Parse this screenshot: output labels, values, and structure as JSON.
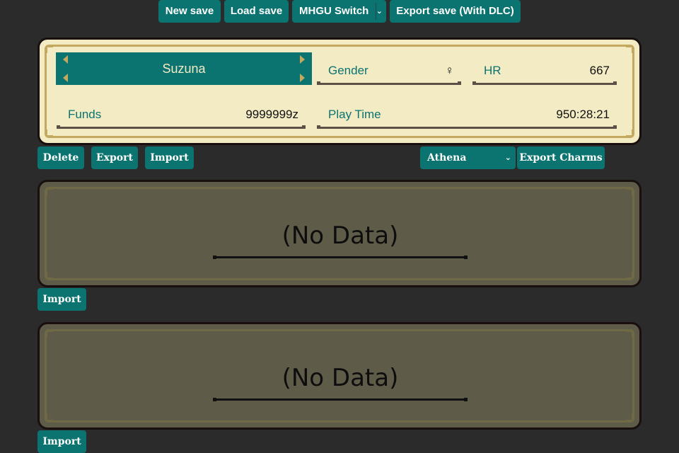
{
  "toolbar": {
    "new_save": "New save",
    "load_save": "Load save",
    "platform_selected": "MHGU Switch",
    "export_dlc": "Export save (With DLC)"
  },
  "slot1": {
    "name": "Suzuna",
    "gender_label": "Gender",
    "gender_value": "♀",
    "hr_label": "HR",
    "hr_value": "667",
    "funds_label": "Funds",
    "funds_value": "9999999z",
    "playtime_label": "Play Time",
    "playtime_value": "950:28:21",
    "actions": {
      "delete": "Delete",
      "export": "Export",
      "import": "Import"
    },
    "charm_select": "Athena",
    "export_charms": "Export Charms"
  },
  "slot2": {
    "status": "(No Data)",
    "import": "Import"
  },
  "slot3": {
    "status": "(No Data)",
    "import": "Import"
  },
  "colors": {
    "accent": "#0b7370",
    "background": "#2b2b2b",
    "card": "#f3ebc4",
    "card_empty": "#5e5b49",
    "gold": "#c4a85f"
  }
}
